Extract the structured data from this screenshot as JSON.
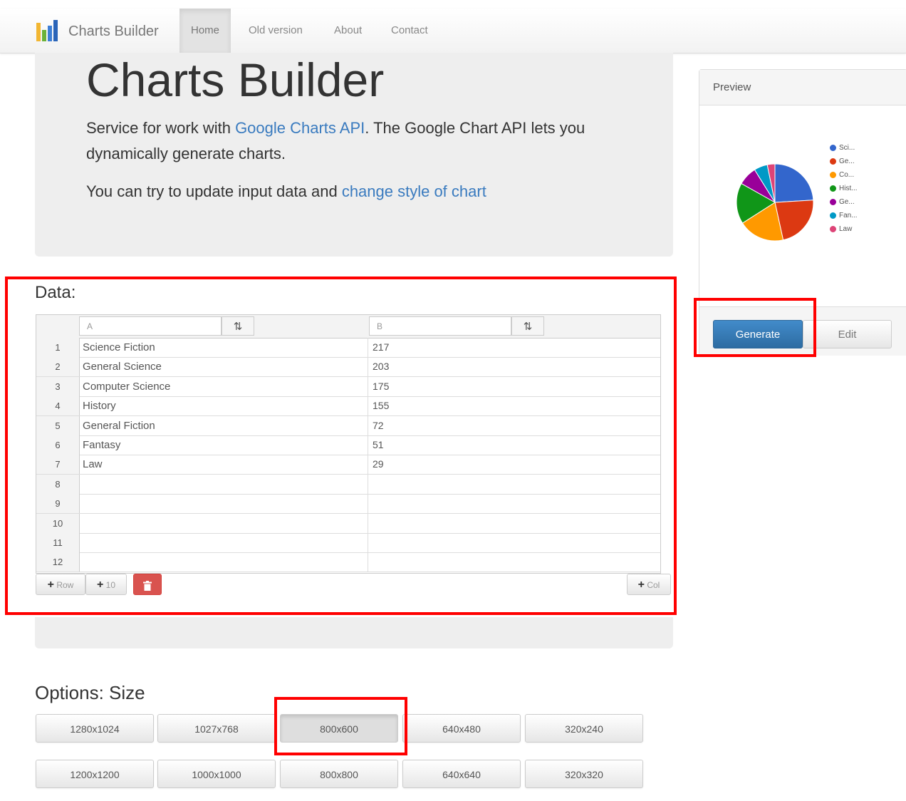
{
  "nav": {
    "brand": "Charts Builder",
    "items": [
      {
        "label": "Home",
        "active": true
      },
      {
        "label": "Old version",
        "active": false
      },
      {
        "label": "About",
        "active": false
      },
      {
        "label": "Contact",
        "active": false
      }
    ]
  },
  "hero": {
    "title": "Charts Builder",
    "line1_pre": "Service for work with ",
    "line1_link": "Google Charts API",
    "line1_post": ". The Google Chart API lets you dynamically generate charts.",
    "line2_pre": "You can try to update input data and ",
    "line2_link": "change style of chart"
  },
  "data": {
    "title": "Data:",
    "columns": [
      "A",
      "B"
    ],
    "sort_icon": "sort-icon",
    "rows": [
      {
        "num": "1",
        "a": "Science Fiction",
        "b": "217"
      },
      {
        "num": "2",
        "a": "General Science",
        "b": "203"
      },
      {
        "num": "3",
        "a": "Computer Science",
        "b": "175"
      },
      {
        "num": "4",
        "a": "History",
        "b": "155"
      },
      {
        "num": "5",
        "a": "General Fiction",
        "b": "72"
      },
      {
        "num": "6",
        "a": "Fantasy",
        "b": "51"
      },
      {
        "num": "7",
        "a": "Law",
        "b": "29"
      },
      {
        "num": "8",
        "a": "",
        "b": ""
      },
      {
        "num": "9",
        "a": "",
        "b": ""
      },
      {
        "num": "10",
        "a": "",
        "b": ""
      },
      {
        "num": "11",
        "a": "",
        "b": ""
      },
      {
        "num": "12",
        "a": "",
        "b": ""
      }
    ],
    "add_row_label": "Row",
    "add_ten_label": "10",
    "add_col_label": "Col",
    "delete_icon": "trash-icon"
  },
  "options": {
    "title": "Options: Size",
    "sizes_row1": [
      "1280x1024",
      "1027x768",
      "800x600",
      "640x480",
      "320x240"
    ],
    "sizes_row2": [
      "1200x1200",
      "1000x1000",
      "800x800",
      "640x640",
      "320x320"
    ],
    "selected": "800x600"
  },
  "preview": {
    "title": "Preview",
    "generate_label": "Generate",
    "edit_label": "Edit",
    "legend": [
      {
        "label": "Sci...",
        "color": "#3366cc"
      },
      {
        "label": "Ge...",
        "color": "#dc3912"
      },
      {
        "label": "Co...",
        "color": "#ff9900"
      },
      {
        "label": "Hist...",
        "color": "#109618"
      },
      {
        "label": "Ge...",
        "color": "#990099"
      },
      {
        "label": "Fan...",
        "color": "#0099c6"
      },
      {
        "label": "Law",
        "color": "#dd4477"
      }
    ]
  },
  "chart_data": {
    "type": "pie",
    "categories": [
      "Science Fiction",
      "General Science",
      "Computer Science",
      "History",
      "General Fiction",
      "Fantasy",
      "Law"
    ],
    "values": [
      217,
      203,
      175,
      155,
      72,
      51,
      29
    ],
    "colors": [
      "#3366cc",
      "#dc3912",
      "#ff9900",
      "#109618",
      "#990099",
      "#0099c6",
      "#dd4477"
    ],
    "legend": "right"
  }
}
